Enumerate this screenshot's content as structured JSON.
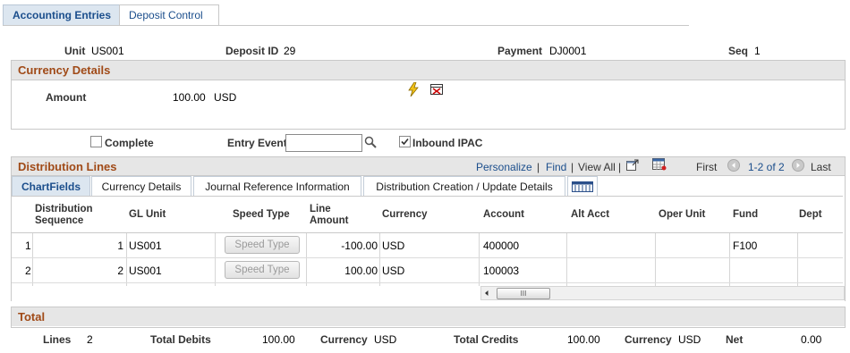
{
  "tabs": [
    {
      "label": "Accounting Entries"
    },
    {
      "label": "Deposit Control"
    }
  ],
  "header": {
    "unit_label": "Unit",
    "unit_value": "US001",
    "deposit_label": "Deposit ID",
    "deposit_value": "29",
    "payment_label": "Payment",
    "payment_value": "DJ0001",
    "seq_label": "Seq",
    "seq_value": "1"
  },
  "currency_details": {
    "title": "Currency Details",
    "amount_label": "Amount",
    "amount_value": "100.00",
    "currency": "USD"
  },
  "options": {
    "complete_label": "Complete",
    "complete_checked": false,
    "entry_event_label": "Entry Event",
    "entry_event_value": "",
    "inbound_ipac_label": "Inbound IPAC",
    "inbound_ipac_checked": true
  },
  "distribution": {
    "title": "Distribution Lines",
    "personalize": "Personalize",
    "find": "Find",
    "view_all": "View All",
    "first": "First",
    "range": "1-2 of 2",
    "last": "Last",
    "tabs": [
      "ChartFields",
      "Currency Details",
      "Journal Reference Information",
      "Distribution Creation / Update Details"
    ],
    "columns": [
      "Distribution Sequence",
      "GL Unit",
      "Speed Type",
      "Line Amount",
      "Currency",
      "Account",
      "Alt Acct",
      "Oper Unit",
      "Fund",
      "Dept"
    ],
    "rows": [
      {
        "num": "1",
        "seq": "1",
        "gl_unit": "US001",
        "speed_type": "Speed Type",
        "amount": "-100.00",
        "currency": "USD",
        "account": "400000",
        "alt_acct": "",
        "oper_unit": "",
        "fund": "F100",
        "dept": ""
      },
      {
        "num": "2",
        "seq": "2",
        "gl_unit": "US001",
        "speed_type": "Speed Type",
        "amount": "100.00",
        "currency": "USD",
        "account": "100003",
        "alt_acct": "",
        "oper_unit": "",
        "fund": "",
        "dept": ""
      }
    ],
    "scroll_grip": "III"
  },
  "total": {
    "title": "Total",
    "lines_label": "Lines",
    "lines_value": "2",
    "total_debits_label": "Total Debits",
    "total_debits_value": "100.00",
    "currency_label_1": "Currency",
    "currency_value_1": "USD",
    "total_credits_label": "Total Credits",
    "total_credits_value": "100.00",
    "currency_label_2": "Currency",
    "currency_value_2": "USD",
    "net_label": "Net",
    "net_value": "0.00"
  }
}
